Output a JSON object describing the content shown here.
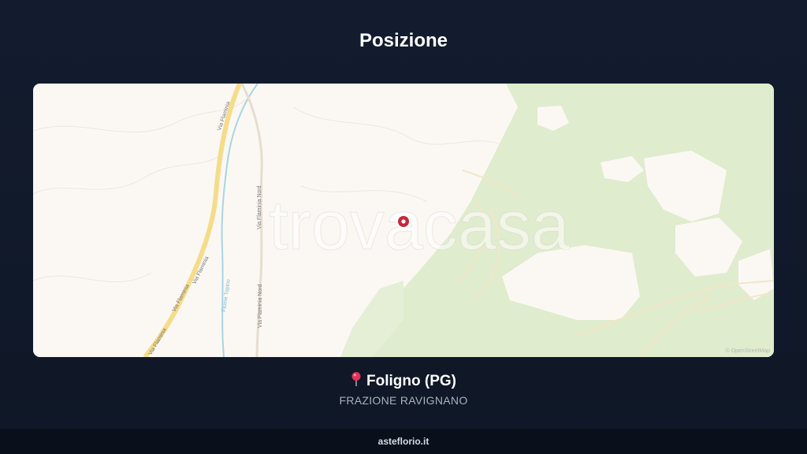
{
  "header": {
    "title": "Posizione"
  },
  "map": {
    "watermark": "trovacasa",
    "attribution": "© OpenStreetMap",
    "roads": {
      "via_flaminia_1": "Via Flaminia",
      "via_flaminia_2": "Via Flaminia",
      "via_flaminia_3": "Via Flaminia",
      "via_flaminia_4": "Via Flaminia",
      "via_flaminia_nord_1": "Via Flaminia Nord",
      "via_flaminia_nord_2": "Via Flaminia Nord",
      "fiume_topino": "Fiume Topino"
    },
    "colors": {
      "land": "#fbf8f4",
      "forest": "#dfeccd",
      "highway": "#f6dc8a",
      "river": "#a9d4e4",
      "marker": "#c7283a"
    }
  },
  "location": {
    "pin_icon": "round-pushpin-icon",
    "city": "Foligno (PG)",
    "area": "FRAZIONE RAVIGNANO"
  },
  "footer": {
    "site": "asteflorio.it"
  }
}
